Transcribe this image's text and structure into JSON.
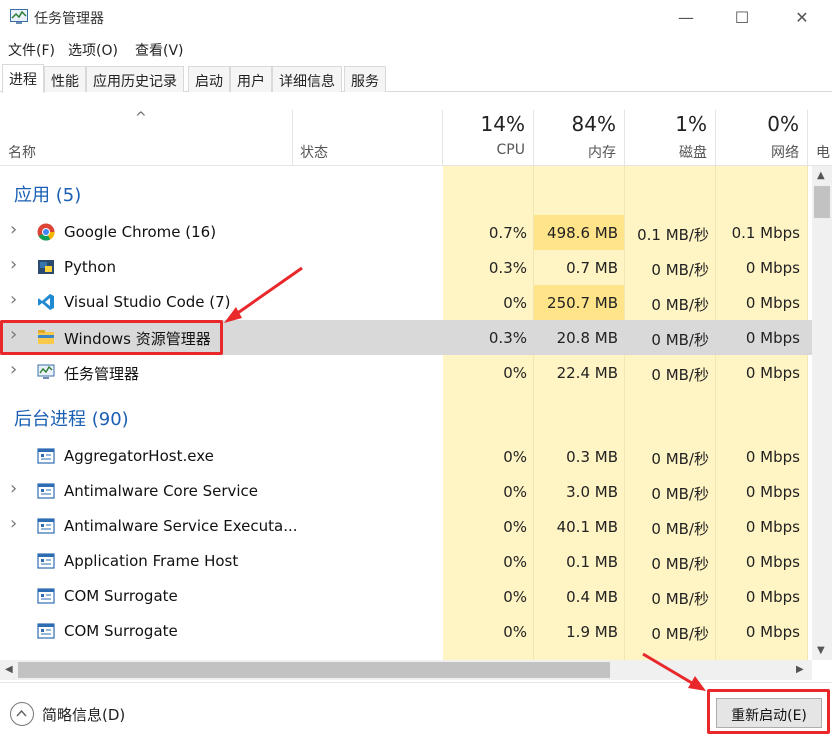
{
  "window": {
    "title": "任务管理器",
    "minimize": "—",
    "maximize": "☐",
    "close": "✕"
  },
  "menu": [
    "文件(F)",
    "选项(O)",
    "查看(V)"
  ],
  "tabs": [
    "进程",
    "性能",
    "应用历史记录",
    "启动",
    "用户",
    "详细信息",
    "服务"
  ],
  "active_tab": "进程",
  "columns": {
    "name": "名称",
    "status": "状态",
    "cpu": {
      "label": "CPU",
      "pct": "14%"
    },
    "memory": {
      "label": "内存",
      "pct": "84%"
    },
    "disk": {
      "label": "磁盘",
      "pct": "1%"
    },
    "network": {
      "label": "网络",
      "pct": "0%"
    },
    "power_truncated": "电"
  },
  "groups": {
    "apps": "应用 (5)",
    "background": "后台进程 (90)"
  },
  "apps": [
    {
      "name": "Google Chrome (16)",
      "icon": "chrome-icon",
      "cpu": "0.7%",
      "mem": "498.6 MB",
      "disk": "0.1 MB/秒",
      "net": "0.1 Mbps",
      "mem_hot": true
    },
    {
      "name": "Python",
      "icon": "python-icon",
      "cpu": "0.3%",
      "mem": "0.7 MB",
      "disk": "0 MB/秒",
      "net": "0 Mbps",
      "mem_hot": false
    },
    {
      "name": "Visual Studio Code (7)",
      "icon": "vscode-icon",
      "cpu": "0%",
      "mem": "250.7 MB",
      "disk": "0 MB/秒",
      "net": "0 Mbps",
      "mem_hot": true
    },
    {
      "name": "Windows 资源管理器",
      "icon": "folder-icon",
      "cpu": "0.3%",
      "mem": "20.8 MB",
      "disk": "0 MB/秒",
      "net": "0 Mbps",
      "mem_hot": false,
      "selected": true
    },
    {
      "name": "任务管理器",
      "icon": "task-manager-icon",
      "cpu": "0%",
      "mem": "22.4 MB",
      "disk": "0 MB/秒",
      "net": "0 Mbps",
      "mem_hot": false
    }
  ],
  "background": [
    {
      "name": "AggregatorHost.exe",
      "expand": false,
      "cpu": "0%",
      "mem": "0.3 MB",
      "disk": "0 MB/秒",
      "net": "0 Mbps"
    },
    {
      "name": "Antimalware Core Service",
      "expand": true,
      "cpu": "0%",
      "mem": "3.0 MB",
      "disk": "0 MB/秒",
      "net": "0 Mbps"
    },
    {
      "name": "Antimalware Service Executa...",
      "expand": true,
      "cpu": "0%",
      "mem": "40.1 MB",
      "disk": "0 MB/秒",
      "net": "0 Mbps"
    },
    {
      "name": "Application Frame Host",
      "expand": false,
      "cpu": "0%",
      "mem": "0.1 MB",
      "disk": "0 MB/秒",
      "net": "0 Mbps"
    },
    {
      "name": "COM Surrogate",
      "expand": false,
      "cpu": "0%",
      "mem": "0.4 MB",
      "disk": "0 MB/秒",
      "net": "0 Mbps"
    },
    {
      "name": "COM Surrogate",
      "expand": false,
      "cpu": "0%",
      "mem": "1.9 MB",
      "disk": "0 MB/秒",
      "net": "0 Mbps"
    }
  ],
  "footer": {
    "fewer_details": "简略信息(D)",
    "restart": "重新启动(E)"
  },
  "colors": {
    "heat_light": "#fff4c4",
    "heat_hot": "#ffe48a",
    "group_blue": "#1a5fb4",
    "annotation_red": "#e8282b"
  }
}
